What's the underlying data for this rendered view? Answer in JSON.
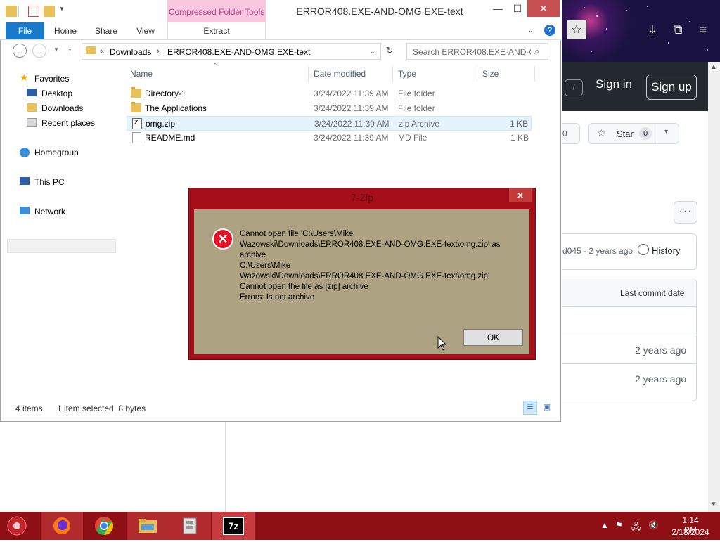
{
  "browser": {
    "github": {
      "shortcut_key": "/",
      "sign_in": "Sign in",
      "sign_up": "Sign up",
      "fork_count": "0",
      "star_label": "Star",
      "star_count": "0",
      "more_dots": "···",
      "commit_text": "d045 · 2 years ago",
      "history": "History",
      "last_commit_date": "Last commit date",
      "rows_ago": [
        "2 years ago",
        "2 years ago"
      ]
    }
  },
  "explorer": {
    "compressed_tools_tab": "Compressed Folder Tools",
    "title": "ERROR408.EXE-AND-OMG.EXE-text",
    "ribbon": {
      "file": "File",
      "home": "Home",
      "share": "Share",
      "view": "View",
      "extract": "Extract"
    },
    "address": {
      "chevrons": "«",
      "segments": [
        "Downloads",
        "ERROR408.EXE-AND-OMG.EXE-text"
      ],
      "search_placeholder": "Search ERROR408.EXE-AND-O..."
    },
    "nav": {
      "favorites": "Favorites",
      "desktop": "Desktop",
      "downloads": "Downloads",
      "recent_places": "Recent places",
      "homegroup": "Homegroup",
      "this_pc": "This PC",
      "network": "Network"
    },
    "columns": {
      "name": "Name",
      "date_modified": "Date modified",
      "type": "Type",
      "size": "Size"
    },
    "files": [
      {
        "name": "Directory-1",
        "date": "3/24/2022 11:39 AM",
        "type": "File folder",
        "size": ""
      },
      {
        "name": "The Applications",
        "date": "3/24/2022 11:39 AM",
        "type": "File folder",
        "size": ""
      },
      {
        "name": "omg.zip",
        "date": "3/24/2022 11:39 AM",
        "type": "zip Archive",
        "size": "1 KB"
      },
      {
        "name": "README.md",
        "date": "3/24/2022 11:39 AM",
        "type": "MD File",
        "size": "1 KB"
      }
    ],
    "status": {
      "items": "4 items",
      "selected": "1 item selected  8 bytes"
    }
  },
  "dialog": {
    "title": "7-Zip",
    "message": "Cannot open file 'C:\\Users\\Mike\nWazowski\\Downloads\\ERROR408.EXE-AND-OMG.EXE-text\\omg.zip' as\narchive\nC:\\Users\\Mike\nWazowski\\Downloads\\ERROR408.EXE-AND-OMG.EXE-text\\omg.zip\nCannot open the file as [zip] archive\nErrors: Is not archive",
    "ok": "OK"
  },
  "taskbar": {
    "time": "1:14 PM",
    "date": "2/18/2024",
    "apps": [
      "firefox",
      "chrome",
      "file-explorer",
      "archive",
      "7-zip"
    ],
    "seven_zip_label": "7z"
  },
  "colors": {
    "taskbar": "#8e0f14",
    "dialog_frame": "#a60e1a",
    "dialog_body": "#ada281",
    "file_tab": "#1979ca",
    "compressed_tab": "#f9c8e0",
    "github_header": "#24292f"
  }
}
